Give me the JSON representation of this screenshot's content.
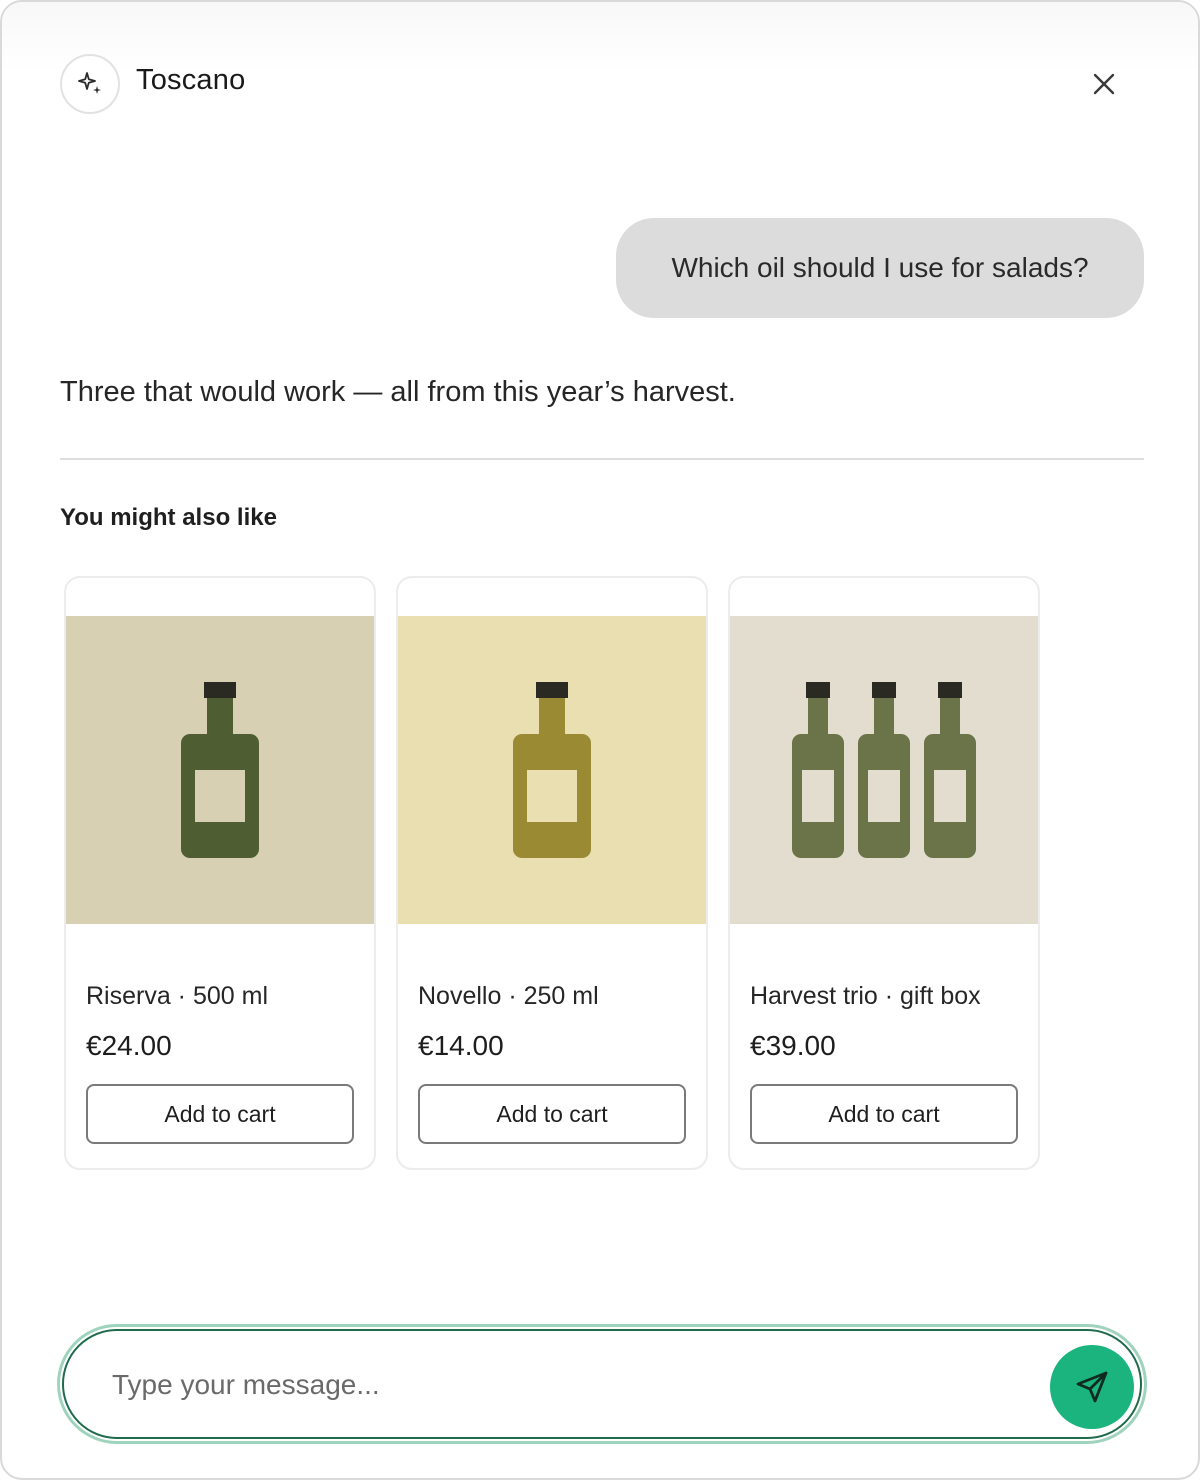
{
  "header": {
    "title": "Toscano",
    "logo_icon": "sparkle-icon",
    "close_icon": "close-icon"
  },
  "conversation": {
    "user_message": "Which oil should I use for salads?",
    "assistant_message": "Three that would work — all from this year’s harvest."
  },
  "recommendations": {
    "heading": "You might also like",
    "products": [
      {
        "name": "Riserva · 500 ml",
        "price": "€24.00",
        "button_label": "Add to cart",
        "image_bg": "#d8d0b2",
        "bottle_color": "#4f5e32",
        "bottle_count": 1
      },
      {
        "name": "Novello · 250 ml",
        "price": "€14.00",
        "button_label": "Add to cart",
        "image_bg": "#e9dfb0",
        "bottle_color": "#9a8a34",
        "bottle_count": 1
      },
      {
        "name": "Harvest trio · gift box",
        "price": "€39.00",
        "button_label": "Add to cart",
        "image_bg": "#e3ddcf",
        "bottle_color": "#6b7449",
        "bottle_count": 3
      }
    ]
  },
  "composer": {
    "placeholder": "Type your message...",
    "send_icon": "send-icon"
  },
  "colors": {
    "accent": "#1bb47e",
    "accent_border": "#1f6b4e",
    "bubble": "#dcdcdc"
  }
}
